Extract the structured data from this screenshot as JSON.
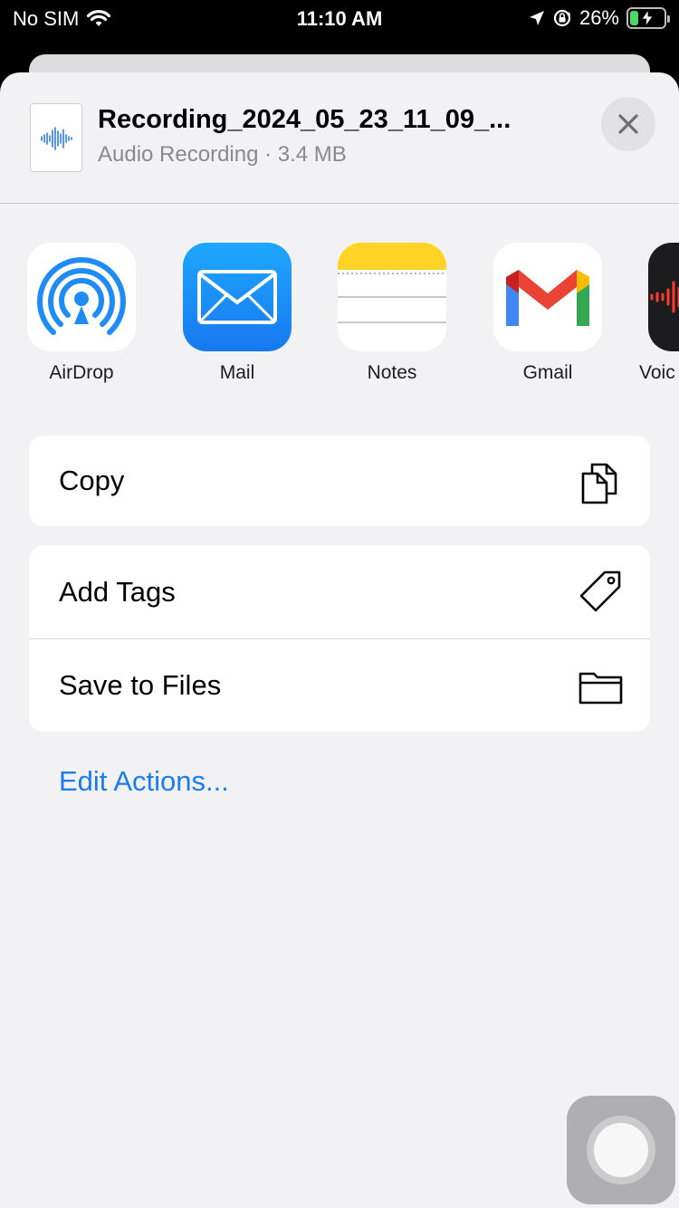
{
  "status_bar": {
    "carrier": "No SIM",
    "time": "11:10 AM",
    "battery": "26%",
    "battery_level": 0.26
  },
  "share_sheet": {
    "file_title": "Recording_2024_05_23_11_09_...",
    "file_subtitle": "Audio Recording · 3.4 MB",
    "apps": [
      {
        "label": "AirDrop",
        "icon": "airdrop-icon"
      },
      {
        "label": "Mail",
        "icon": "mail-icon"
      },
      {
        "label": "Notes",
        "icon": "notes-icon"
      },
      {
        "label": "Gmail",
        "icon": "gmail-icon"
      },
      {
        "label": "Voic",
        "icon": "voice-memos-icon"
      }
    ],
    "actions": {
      "copy": "Copy",
      "add_tags": "Add Tags",
      "save_to_files": "Save to Files"
    },
    "edit_actions": "Edit Actions..."
  },
  "colors": {
    "accent": "#1a7cf0",
    "sheet_bg": "#f2f2f4",
    "gmail_red": "#ea4335",
    "mail_blue": "#1a8cf7",
    "notes_yellow": "#ffd426"
  }
}
